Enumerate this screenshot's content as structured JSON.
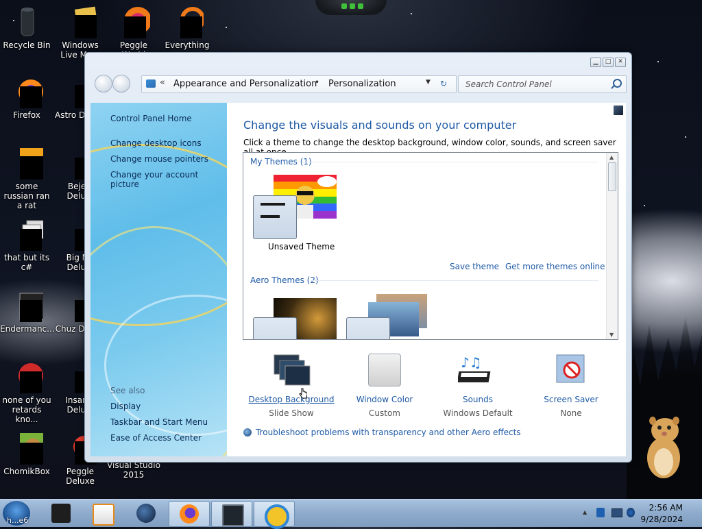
{
  "desktop": {
    "icons": [
      {
        "label": "Recycle Bin"
      },
      {
        "label": "Windows Live Ma..."
      },
      {
        "label": "Peggle World"
      },
      {
        "label": "Everything"
      },
      {
        "label": "Firefox"
      },
      {
        "label": "Astro Delu..."
      },
      {
        "label": "some russian ran a rat"
      },
      {
        "label": "Bejew Delu..."
      },
      {
        "label": "that but its c#"
      },
      {
        "label": "Big Mo Delu..."
      },
      {
        "label": "Endermanc..."
      },
      {
        "label": "Chuz Delu..."
      },
      {
        "label": "none of you retards kno..."
      },
      {
        "label": "Insaniq Delu..."
      },
      {
        "label": "ChomikBox"
      },
      {
        "label": "Peggle Deluxe"
      },
      {
        "label": "Visual Studio 2015"
      }
    ]
  },
  "window": {
    "caption_buttons": {
      "minimize": "▁",
      "maximize": "□",
      "close": "✕"
    },
    "address": {
      "chevron": "«",
      "crumb1": "Appearance and Personalization",
      "separator": "•",
      "crumb2": "Personalization",
      "dropdown": "▼",
      "refresh": "↻"
    },
    "search": {
      "placeholder": "Search Control Panel"
    },
    "left_pane": {
      "home": "Control Panel Home",
      "links": [
        "Change desktop icons",
        "Change mouse pointers",
        "Change your account picture"
      ],
      "see_also_header": "See also",
      "see_also": [
        "Display",
        "Taskbar and Start Menu",
        "Ease of Access Center"
      ]
    },
    "main": {
      "heading": "Change the visuals and sounds on your computer",
      "subtext": "Click a theme to change the desktop background, window color, sounds, and screen saver all at once.",
      "my_themes_label": "My Themes (1)",
      "unsaved_theme": "Unsaved Theme",
      "save_theme": "Save theme",
      "get_more": "Get more themes online",
      "aero_themes_label": "Aero Themes (2)",
      "bottom": [
        {
          "label": "Desktop Background",
          "sub": "Slide Show"
        },
        {
          "label": "Window Color",
          "sub": "Custom"
        },
        {
          "label": "Sounds",
          "sub": "Windows Default"
        },
        {
          "label": "Screen Saver",
          "sub": "None"
        }
      ],
      "troubleshoot": "Troubleshoot problems with transparency and other Aero effects"
    }
  },
  "taskbar": {
    "start_overlay": "h...e6",
    "time": "2:56 AM",
    "date": "9/28/2024",
    "tray_arrow": "▲"
  },
  "colors": {
    "link": "#1e5aa6",
    "heading": "#1e5aa6",
    "taskbar": "#8eabcc"
  }
}
